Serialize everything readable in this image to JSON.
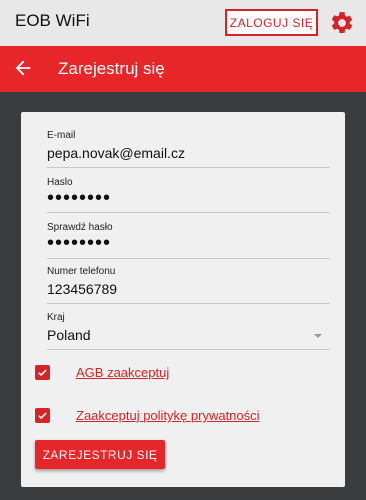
{
  "header": {
    "app_title": "EOB WiFi",
    "login_label": "ZALOGUJ SIĘ"
  },
  "toolbar": {
    "title": "Zarejestruj się"
  },
  "form": {
    "email": {
      "label": "E-mail",
      "value": "pepa.novak@email.cz"
    },
    "password": {
      "label": "Haslo",
      "value": "••••••••"
    },
    "password_confirm": {
      "label": "Sprawdź hasło",
      "value": "••••••••"
    },
    "phone": {
      "label": "Numer telefonu",
      "value": "123456789"
    },
    "country": {
      "label": "Kraj",
      "value": "Poland"
    },
    "agb_label": "AGB zaakceptuj",
    "privacy_label": "Zaakceptuj politykę prywatności",
    "register_label": "ZAREJESTRUJ SIĘ"
  },
  "colors": {
    "accent": "#e7262a",
    "background": "#3a3c3e",
    "card": "#f0f0f0"
  },
  "icons": {
    "settings": "gear-icon",
    "back": "arrow-left-icon",
    "check": "checkmark-icon",
    "dropdown": "caret-down-icon"
  }
}
